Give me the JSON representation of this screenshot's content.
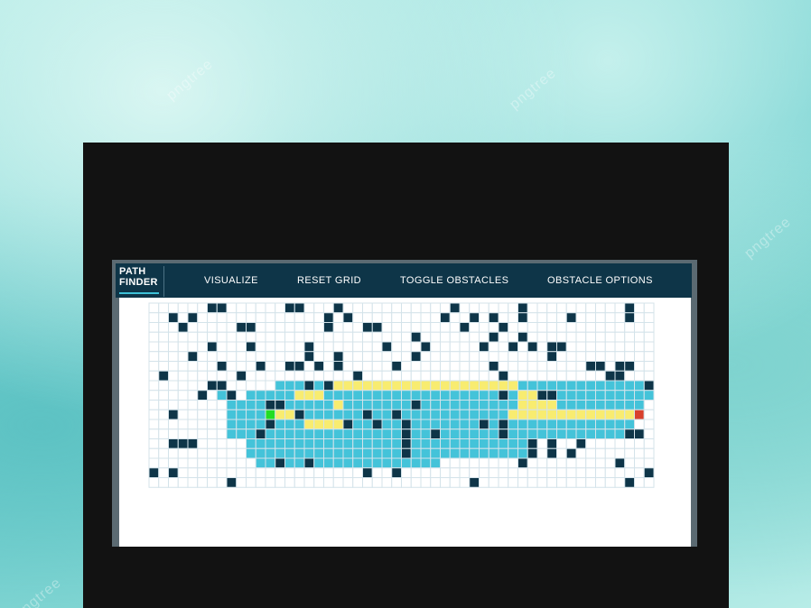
{
  "window_title": "PATH FINDER",
  "brand": {
    "line1": "PATH",
    "line2": "FINDER"
  },
  "nav": [
    {
      "label": "VISUALIZE"
    },
    {
      "label": "RESET GRID"
    },
    {
      "label": "TOGGLE OBSTACLES"
    },
    {
      "label": "OBSTACLE OPTIONS"
    }
  ],
  "watermark": "pngtree",
  "colors": {
    "navbar": "#0e3548",
    "wall": "#0e3548",
    "visited": "#44c3d9",
    "path": "#f8ec70",
    "start": "#22dd22",
    "end": "#d8402c",
    "empty": "#ffffff",
    "grid_line": "#d4e3ea"
  },
  "grid": {
    "cols": 52,
    "rows": 19,
    "legend": {
      ".": "empty",
      "#": "wall",
      "v": "visited",
      "p": "path",
      "S": "start",
      "E": "end"
    },
    "cells": [
      "......##......##...#...........#......#..........#..",
      "..#.#.............#.#.........#..#.#..#....#.....#..",
      "...#.....##.......#...##........#...#...............",
      "...........................#.......#..#.............",
      "......#...#.....#.......#...#.....#..#.#.##.........",
      "....#...........#..#.......#.............#..........",
      ".......#...#..##.#.#.....#.........#.........##.##..",
      ".#.......#...........#..............#..........##...",
      "......##.....vvv#v#pppppppppppppppppppvvvvvvvvvvvvv#",
      ".....#.v#.vvvvvpppvvvvvvvvvvvvvvvvvv#vpp##vvvvvvvvvv",
      "........vvvv##vvvvvpvvvvvvv#vvvvvvvvvvppppvvvvvvvvv.",
      "..#.....vvvvSpp#vvvvvv#vv#vvvvvvvvvvvpppppppppppppE.",
      "........vvvv#vvvpppp#vv#vv#vvvvvvv#v#vvvvvvvvvvvvv..",
      "........vvv#vvvvvvvvvvvvvv#vv#vvvvvv#vvvvvvvvvvvv##.",
      "..###.....vvvvvvvvvvvvvvvv#vvvvvvvvvvvv#.#..#.......",
      "..........vvvvvvvvvvvvvvvv#vvvvvvvvvvvv#.#.#........",
      "...........vv#vv#vvvvvvvvvvvvv........#.........#...",
      "#.#...................#..#.........................#",
      "........#........................#...............#.."
    ]
  }
}
